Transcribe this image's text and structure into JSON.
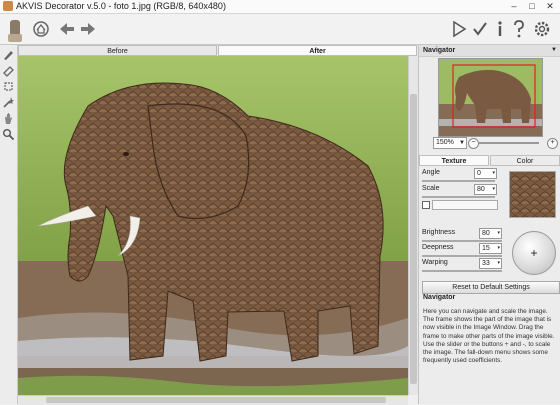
{
  "window": {
    "title": "AKVIS Decorator v.5.0 - foto 1.jpg (RGB/8, 640x480)",
    "minimize": "–",
    "maximize": "□",
    "close": "✕"
  },
  "toolbar": {
    "icons_left": [
      "decorator-logo-icon",
      "home-icon",
      "undo-icon",
      "redo-icon"
    ],
    "icons_right": [
      "run-icon",
      "apply-icon",
      "info-icon",
      "help-icon",
      "settings-icon"
    ]
  },
  "left_tools": [
    "decoration-brush-icon",
    "eraser-icon",
    "selection-icon",
    "magic-wand-icon",
    "hand-icon",
    "zoom-icon"
  ],
  "view_tabs": {
    "before": "Before",
    "after": "After"
  },
  "navigator": {
    "header": "Navigator",
    "zoom_value": "150%",
    "zoom_minus": "−",
    "zoom_plus": "+"
  },
  "settings_tabs": {
    "texture": "Texture",
    "color": "Color"
  },
  "texture_settings": {
    "angle_label": "Angle",
    "angle_value": "0",
    "scale_label": "Scale",
    "scale_value": "80",
    "brightness_label": "Brightness",
    "brightness_value": "80",
    "deepness_label": "Deepness",
    "deepness_value": "15",
    "warping_label": "Warping",
    "warping_value": "33"
  },
  "reset_button": "Reset to Default Settings",
  "help": {
    "title": "Navigator",
    "text": "Here you can navigate and scale the image. The frame shows the part of the image that is now visible in the Image Window. Drag the frame to make other parts of the image visible. Use the slider or the buttons + and -, to scale the image. The fall-down menu shows some frequently used coefficients."
  },
  "colors": {
    "accent": "#e02020",
    "panel_bg": "#ececec",
    "grass": "#8fae50",
    "elephant": "#7a5a40"
  }
}
